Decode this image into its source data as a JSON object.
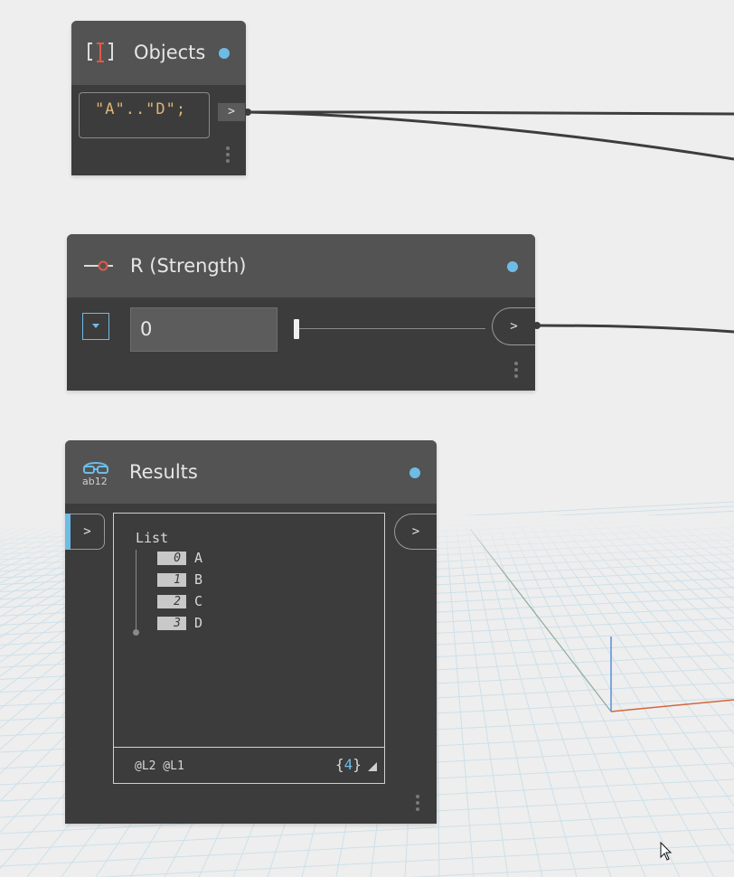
{
  "nodes": {
    "objects": {
      "title": "Objects",
      "code": "\"A\"..\"D\";",
      "output_port": ">"
    },
    "slider": {
      "title": "R (Strength)",
      "value": "0",
      "output_port": ">"
    },
    "results": {
      "title": "Results",
      "input_port": ">",
      "output_port": ">",
      "watch": {
        "header": "List",
        "items": [
          {
            "index": "0",
            "value": "A"
          },
          {
            "index": "1",
            "value": "B"
          },
          {
            "index": "2",
            "value": "C"
          },
          {
            "index": "3",
            "value": "D"
          }
        ],
        "levels": "@L2 @L1",
        "count_open": "{",
        "count": "4",
        "count_close": "}"
      }
    }
  },
  "colors": {
    "node_body": "#3c3c3c",
    "node_header": "#535353",
    "status_dot": "#6dbce6",
    "code_text": "#e0b377",
    "wire": "#3d3d3d",
    "active_port": "#6dbce6",
    "count_accent": "#6dbce6",
    "grid_line": "#cde0ea",
    "axis_x": "#d2673c",
    "axis_y": "#5a8fd8"
  },
  "icons": {
    "objects": "code-block-icon",
    "slider": "slider-icon",
    "results": "watch-icon",
    "cursor": "mouse-pointer-icon"
  }
}
